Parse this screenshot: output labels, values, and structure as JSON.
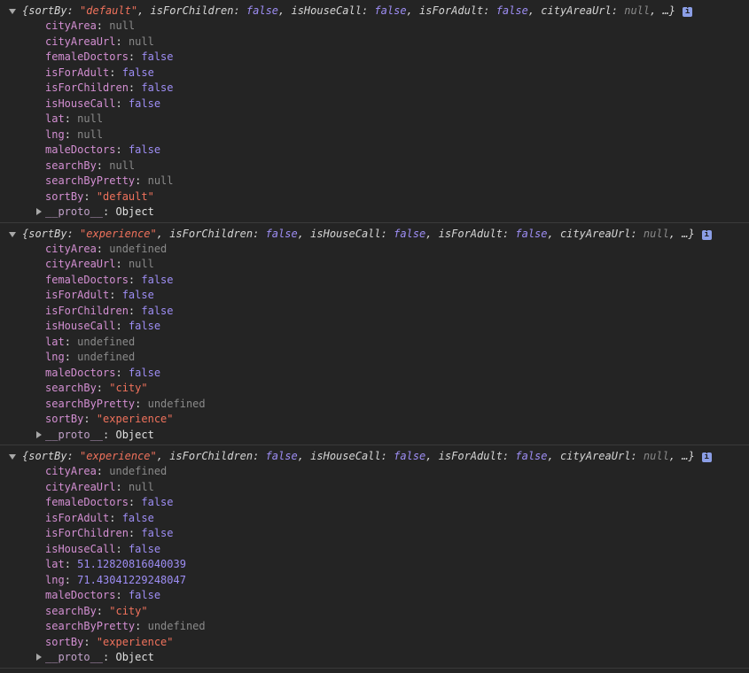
{
  "entries": [
    {
      "summary": [
        {
          "t": "text",
          "v": "{"
        },
        {
          "t": "key",
          "v": "sortBy"
        },
        {
          "t": "text",
          "v": ": "
        },
        {
          "t": "str",
          "v": "\"default\""
        },
        {
          "t": "text",
          "v": ", "
        },
        {
          "t": "key",
          "v": "isForChildren"
        },
        {
          "t": "text",
          "v": ": "
        },
        {
          "t": "bool",
          "v": "false"
        },
        {
          "t": "text",
          "v": ", "
        },
        {
          "t": "key",
          "v": "isHouseCall"
        },
        {
          "t": "text",
          "v": ": "
        },
        {
          "t": "bool",
          "v": "false"
        },
        {
          "t": "text",
          "v": ", "
        },
        {
          "t": "key",
          "v": "isForAdult"
        },
        {
          "t": "text",
          "v": ": "
        },
        {
          "t": "bool",
          "v": "false"
        },
        {
          "t": "text",
          "v": ", "
        },
        {
          "t": "key",
          "v": "cityAreaUrl"
        },
        {
          "t": "text",
          "v": ": "
        },
        {
          "t": "null",
          "v": "null"
        },
        {
          "t": "text",
          "v": ", …}"
        }
      ],
      "props": [
        {
          "key": "cityArea",
          "value": "null",
          "type": "null"
        },
        {
          "key": "cityAreaUrl",
          "value": "null",
          "type": "null"
        },
        {
          "key": "femaleDoctors",
          "value": "false",
          "type": "bool"
        },
        {
          "key": "isForAdult",
          "value": "false",
          "type": "bool"
        },
        {
          "key": "isForChildren",
          "value": "false",
          "type": "bool"
        },
        {
          "key": "isHouseCall",
          "value": "false",
          "type": "bool"
        },
        {
          "key": "lat",
          "value": "null",
          "type": "null"
        },
        {
          "key": "lng",
          "value": "null",
          "type": "null"
        },
        {
          "key": "maleDoctors",
          "value": "false",
          "type": "bool"
        },
        {
          "key": "searchBy",
          "value": "null",
          "type": "null"
        },
        {
          "key": "searchByPretty",
          "value": "null",
          "type": "null"
        },
        {
          "key": "sortBy",
          "value": "\"default\"",
          "type": "str"
        }
      ],
      "proto": {
        "key": "__proto__",
        "value": "Object"
      }
    },
    {
      "summary": [
        {
          "t": "text",
          "v": "{"
        },
        {
          "t": "key",
          "v": "sortBy"
        },
        {
          "t": "text",
          "v": ": "
        },
        {
          "t": "str",
          "v": "\"experience\""
        },
        {
          "t": "text",
          "v": ", "
        },
        {
          "t": "key",
          "v": "isForChildren"
        },
        {
          "t": "text",
          "v": ": "
        },
        {
          "t": "bool",
          "v": "false"
        },
        {
          "t": "text",
          "v": ", "
        },
        {
          "t": "key",
          "v": "isHouseCall"
        },
        {
          "t": "text",
          "v": ": "
        },
        {
          "t": "bool",
          "v": "false"
        },
        {
          "t": "text",
          "v": ", "
        },
        {
          "t": "key",
          "v": "isForAdult"
        },
        {
          "t": "text",
          "v": ": "
        },
        {
          "t": "bool",
          "v": "false"
        },
        {
          "t": "text",
          "v": ", "
        },
        {
          "t": "key",
          "v": "cityAreaUrl"
        },
        {
          "t": "text",
          "v": ": "
        },
        {
          "t": "null",
          "v": "null"
        },
        {
          "t": "text",
          "v": ", …}"
        }
      ],
      "props": [
        {
          "key": "cityArea",
          "value": "undefined",
          "type": "undef"
        },
        {
          "key": "cityAreaUrl",
          "value": "null",
          "type": "null"
        },
        {
          "key": "femaleDoctors",
          "value": "false",
          "type": "bool"
        },
        {
          "key": "isForAdult",
          "value": "false",
          "type": "bool"
        },
        {
          "key": "isForChildren",
          "value": "false",
          "type": "bool"
        },
        {
          "key": "isHouseCall",
          "value": "false",
          "type": "bool"
        },
        {
          "key": "lat",
          "value": "undefined",
          "type": "undef"
        },
        {
          "key": "lng",
          "value": "undefined",
          "type": "undef"
        },
        {
          "key": "maleDoctors",
          "value": "false",
          "type": "bool"
        },
        {
          "key": "searchBy",
          "value": "\"city\"",
          "type": "str"
        },
        {
          "key": "searchByPretty",
          "value": "undefined",
          "type": "undef"
        },
        {
          "key": "sortBy",
          "value": "\"experience\"",
          "type": "str"
        }
      ],
      "proto": {
        "key": "__proto__",
        "value": "Object"
      }
    },
    {
      "summary": [
        {
          "t": "text",
          "v": "{"
        },
        {
          "t": "key",
          "v": "sortBy"
        },
        {
          "t": "text",
          "v": ": "
        },
        {
          "t": "str",
          "v": "\"experience\""
        },
        {
          "t": "text",
          "v": ", "
        },
        {
          "t": "key",
          "v": "isForChildren"
        },
        {
          "t": "text",
          "v": ": "
        },
        {
          "t": "bool",
          "v": "false"
        },
        {
          "t": "text",
          "v": ", "
        },
        {
          "t": "key",
          "v": "isHouseCall"
        },
        {
          "t": "text",
          "v": ": "
        },
        {
          "t": "bool",
          "v": "false"
        },
        {
          "t": "text",
          "v": ", "
        },
        {
          "t": "key",
          "v": "isForAdult"
        },
        {
          "t": "text",
          "v": ": "
        },
        {
          "t": "bool",
          "v": "false"
        },
        {
          "t": "text",
          "v": ", "
        },
        {
          "t": "key",
          "v": "cityAreaUrl"
        },
        {
          "t": "text",
          "v": ": "
        },
        {
          "t": "null",
          "v": "null"
        },
        {
          "t": "text",
          "v": ", …}"
        }
      ],
      "props": [
        {
          "key": "cityArea",
          "value": "undefined",
          "type": "undef"
        },
        {
          "key": "cityAreaUrl",
          "value": "null",
          "type": "null"
        },
        {
          "key": "femaleDoctors",
          "value": "false",
          "type": "bool"
        },
        {
          "key": "isForAdult",
          "value": "false",
          "type": "bool"
        },
        {
          "key": "isForChildren",
          "value": "false",
          "type": "bool"
        },
        {
          "key": "isHouseCall",
          "value": "false",
          "type": "bool"
        },
        {
          "key": "lat",
          "value": "51.12820816040039",
          "type": "num"
        },
        {
          "key": "lng",
          "value": "71.43041229248047",
          "type": "num"
        },
        {
          "key": "maleDoctors",
          "value": "false",
          "type": "bool"
        },
        {
          "key": "searchBy",
          "value": "\"city\"",
          "type": "str"
        },
        {
          "key": "searchByPretty",
          "value": "undefined",
          "type": "undef"
        },
        {
          "key": "sortBy",
          "value": "\"experience\"",
          "type": "str"
        }
      ],
      "proto": {
        "key": "__proto__",
        "value": "Object"
      }
    }
  ],
  "info_icon_label": "i",
  "colors": {
    "background": "#242424",
    "key": "#d38fd2",
    "string": "#f0725c",
    "boolean_number": "#9e8ef5",
    "null_undefined": "#8a8a8a",
    "info_icon": "#8b9ee6"
  },
  "icons": {
    "expand_open": "triangle-down-icon",
    "expand_closed": "triangle-right-icon",
    "info": "info-icon"
  }
}
